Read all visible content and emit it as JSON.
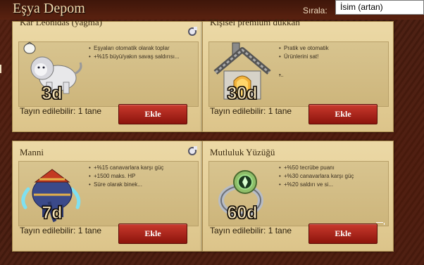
{
  "header": {
    "title": "Eşya Depom",
    "sort_label": "Sırala:",
    "sort_value": "İsim (artan)"
  },
  "cards": [
    {
      "title": "Kar Leonidas (yağma)",
      "description": [
        "Eşyaları otomatik olarak toplar",
        "+%15 büyü/yakın savaş saldırısı..."
      ],
      "days": "3d",
      "assignable": "Tayın edilebilir: 1 tane",
      "button": "Ekle",
      "icon": "white-lion-mount-icon"
    },
    {
      "title": "Kişisel premium dükkan",
      "description": [
        "Pratik ve otomatik",
        "Ürünlerini sat!",
        "..."
      ],
      "days": "30d",
      "assignable": "Tayın edilebilir: 1 tane",
      "button": "Ekle",
      "icon": "market-stall-icon"
    },
    {
      "title": "Manni",
      "description": [
        "+%15 canavarlara karşı güç",
        "+1500 maks. HP",
        "Süre olarak binek..."
      ],
      "days": "7d",
      "assignable": "Tayın edilebilir: 1 tane",
      "button": "Ekle",
      "icon": "mammoth-mount-icon"
    },
    {
      "title": "Mutluluk Yüzüğü",
      "description": [
        "+%50 tecrübe puanı",
        "+%30 canavarlara karşı güç",
        "+%20 saldırı ve si..."
      ],
      "days": "60d",
      "assignable": "Tayın edilebilir: 1 tane",
      "button": "Ekle",
      "icon": "ring-icon"
    }
  ]
}
